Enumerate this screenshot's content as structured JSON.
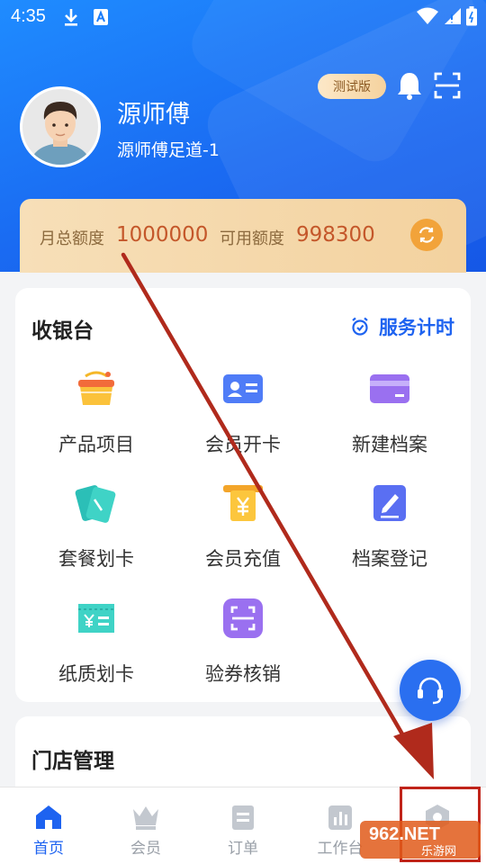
{
  "status_bar": {
    "time": "4:35"
  },
  "header": {
    "test_badge": "测试版",
    "user_name": "源师傅",
    "store_name": "源师傅足道-1"
  },
  "quota": {
    "monthly_label": "月总额度",
    "monthly_value": "1000000",
    "available_label": "可用额度",
    "available_value": "998300"
  },
  "cashier": {
    "title": "收银台",
    "timer_label": "服务计时",
    "items": [
      {
        "label": "产品项目",
        "icon": "basket-icon"
      },
      {
        "label": "会员开卡",
        "icon": "member-card-icon"
      },
      {
        "label": "新建档案",
        "icon": "credit-card-icon"
      },
      {
        "label": "套餐划卡",
        "icon": "package-card-icon"
      },
      {
        "label": "会员充值",
        "icon": "yen-recharge-icon"
      },
      {
        "label": "档案登记",
        "icon": "edit-record-icon"
      },
      {
        "label": "纸质划卡",
        "icon": "paper-ticket-icon"
      },
      {
        "label": "验券核销",
        "icon": "scan-coupon-icon"
      }
    ]
  },
  "store_mgmt": {
    "title": "门店管理"
  },
  "tabbar": {
    "tabs": [
      {
        "label": "首页",
        "icon": "home-icon",
        "active": true
      },
      {
        "label": "会员",
        "icon": "crown-icon",
        "active": false
      },
      {
        "label": "订单",
        "icon": "order-icon",
        "active": false
      },
      {
        "label": "工作台",
        "icon": "chart-icon",
        "active": false
      },
      {
        "label": "",
        "icon": "profile-icon",
        "active": false
      }
    ]
  },
  "watermark": {
    "text": "962.NET 乐游网"
  },
  "colors": {
    "primary": "#1e63f0",
    "accent_orange": "#f2a33a",
    "annotation_red": "#c0241a"
  }
}
